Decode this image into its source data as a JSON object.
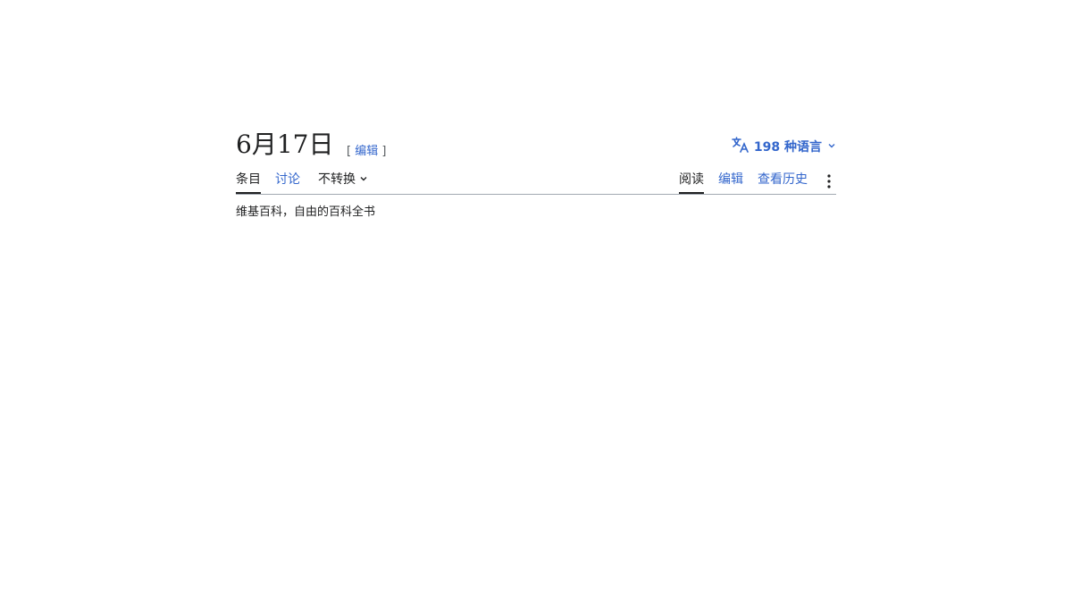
{
  "article": {
    "title": "6月17日",
    "title_edit_label": "编辑",
    "language_button_label": "198 种语言",
    "tabs": {
      "article": "条目",
      "talk": "讨论",
      "variant": "不转换",
      "read": "阅读",
      "edit": "编辑",
      "history": "查看历史"
    },
    "tagline": "维基百科，自由的百科全书"
  },
  "icons": {
    "language": "language-icon",
    "chevron": "chevron-down-icon",
    "more": "more-menu-icon"
  },
  "colors": {
    "link": "#3366cc",
    "text": "#202122",
    "border": "#a2a9b1"
  }
}
